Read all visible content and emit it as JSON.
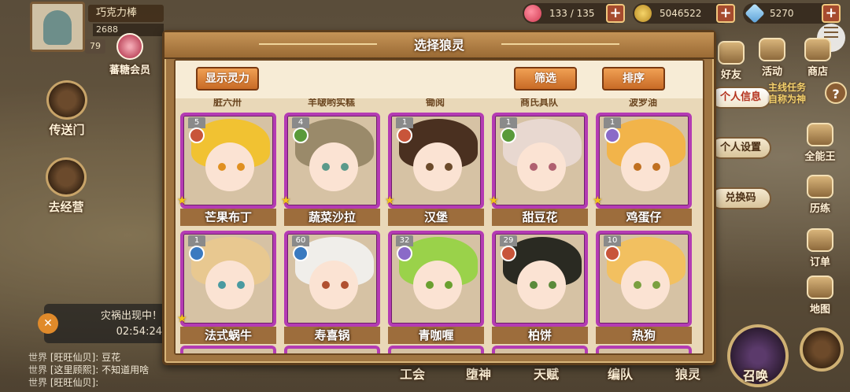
{
  "player": {
    "name": "巧克力棒",
    "id": "2688",
    "level": "79",
    "vip_label": "蕃糖会员"
  },
  "resources": [
    {
      "value": "133 / 135"
    },
    {
      "value": "5046522"
    },
    {
      "value": "5270"
    }
  ],
  "right_menu": {
    "friends": "好友",
    "events": "活动",
    "shop": "商店",
    "personal_info": "个人信息",
    "quest_line1": "主线任务",
    "quest_line2": "自称为神",
    "settings": "个人设置",
    "redeem": "兑换码",
    "master": "全能王",
    "train": "历练",
    "orders": "订单",
    "map": "地图"
  },
  "left_menu": {
    "portal": "传送门",
    "go_manage": "去经营"
  },
  "disaster": {
    "text": "灾祸出现中！",
    "timer": "02:54:24"
  },
  "chat": [
    {
      "channel": "世界",
      "text": "[旺旺仙贝]: 豆花"
    },
    {
      "channel": "世界",
      "text": "[这里顾熙]: 不知道用啥"
    },
    {
      "channel": "世界",
      "text": "[旺旺仙贝]:"
    }
  ],
  "bottom_nav": [
    "工会",
    "堕神",
    "天赋",
    "编队",
    "狼灵",
    "召唤"
  ],
  "modal": {
    "title": "选择狼灵",
    "show_power_button": "显示灵力",
    "filter_button": "筛选",
    "sort_button": "排序",
    "top_partial_names": [
      "脏六卅",
      "羊啵哟实糕",
      "锄阅",
      "商氏具队",
      "波罗油"
    ],
    "cards": [
      {
        "name": "芒果布丁",
        "level": "5",
        "gem": "fire",
        "starred": true,
        "hair": "#f1c232",
        "eye": "#e09020"
      },
      {
        "name": "蔬菜沙拉",
        "level": "4",
        "gem": "leaf",
        "starred": true,
        "hair": "#9a8a6a",
        "eye": "#5a9a8a"
      },
      {
        "name": "汉堡",
        "level": "1",
        "gem": "fire",
        "starred": true,
        "hair": "#4a3020",
        "eye": "#6b4a2a"
      },
      {
        "name": "甜豆花",
        "level": "1",
        "gem": "leaf",
        "starred": true,
        "hair": "#e8d8d0",
        "eye": "#b06070"
      },
      {
        "name": "鸡蛋仔",
        "level": "1",
        "gem": "light",
        "starred": true,
        "hair": "#f2b44a",
        "eye": "#c07020"
      },
      {
        "name": "法式蜗牛",
        "level": "1",
        "gem": "water",
        "starred": true,
        "hair": "#e8c890",
        "eye": "#4a9aa0"
      },
      {
        "name": "寿喜锅",
        "level": "60",
        "gem": "water",
        "starred": false,
        "hair": "#f0eeea",
        "eye": "#b05030"
      },
      {
        "name": "青咖喱",
        "level": "32",
        "gem": "light",
        "starred": false,
        "hair": "#9ad24a",
        "eye": "#6aa030"
      },
      {
        "name": "柏饼",
        "level": "29",
        "gem": "fire",
        "starred": false,
        "hair": "#2a2a22",
        "eye": "#5a8a3a"
      },
      {
        "name": "热狗",
        "level": "10",
        "gem": "fire",
        "starred": false,
        "hair": "#f2c060",
        "eye": "#7aa040"
      }
    ]
  },
  "colors": {
    "card_border": "#b43bb3",
    "gem_fire": "#c8553a",
    "gem_leaf": "#5a9a3a",
    "gem_water": "#3a7ac0",
    "gem_light": "#8a6ac8"
  }
}
